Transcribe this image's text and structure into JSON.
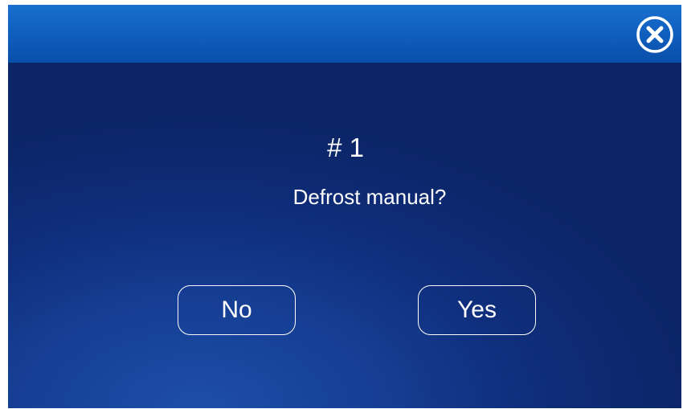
{
  "titlebar": {
    "close_icon": "close-circle-icon"
  },
  "dialog": {
    "heading": "# 1",
    "question": "Defrost manual?",
    "no_label": "No",
    "yes_label": "Yes"
  },
  "colors": {
    "titlebar": "#0f5fbf",
    "background": "#0f2e7c",
    "text": "#ffffff"
  }
}
